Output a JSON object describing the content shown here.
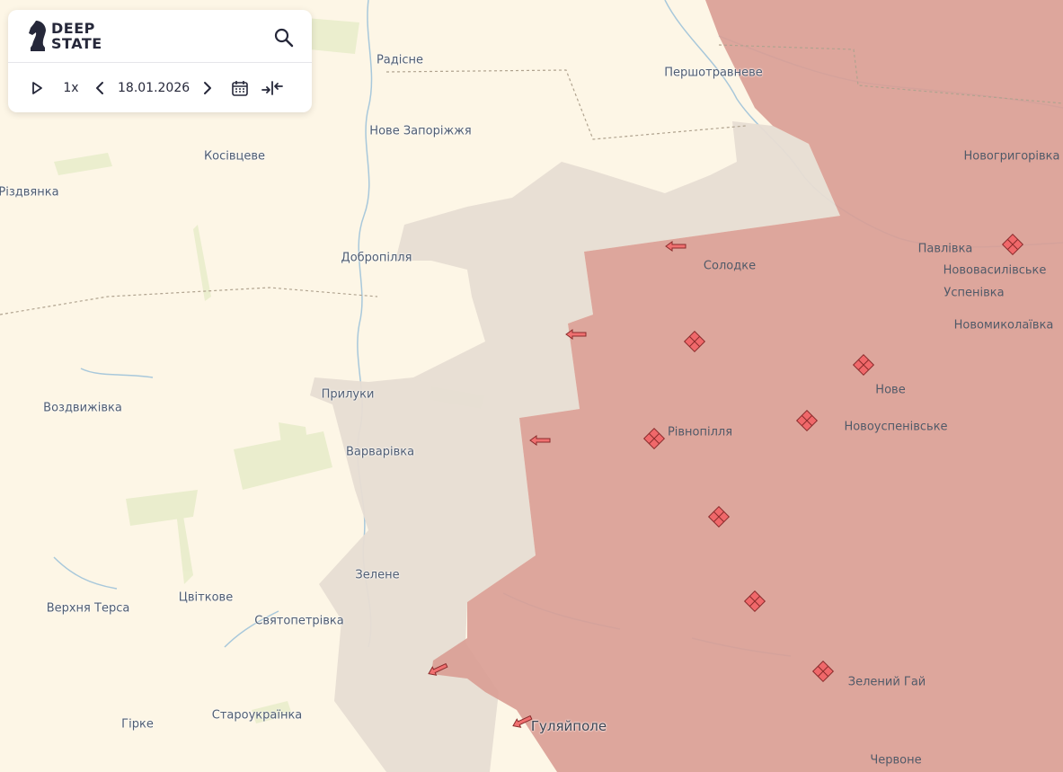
{
  "brand": {
    "line1": "DEEP",
    "line2": "STATE"
  },
  "timeline": {
    "speed": "1x",
    "date": "18.01.2026"
  },
  "icons": {
    "logo": "knight-chess-piece-icon",
    "search": "search-icon",
    "play": "play-icon",
    "prev": "chevron-left-icon",
    "next": "chevron-right-icon",
    "calendar": "calendar-icon",
    "collapse": "collapse-arrows-icon",
    "attack": "attack-arrow-icon",
    "fortification": "fortification-marker-icon"
  },
  "colors": {
    "background": "#fdf6e6",
    "occupied": "#d99d93",
    "contested": "#e7ddd3",
    "marker": "#f0686a"
  },
  "places": [
    {
      "name": "Радісне"
    },
    {
      "name": "Першотравневе"
    },
    {
      "name": "Нове Запоріжжя"
    },
    {
      "name": "Косівцеве"
    },
    {
      "name": "Новогригорівка"
    },
    {
      "name": "Різдвянка"
    },
    {
      "name": "Добропілля"
    },
    {
      "name": "Солодке"
    },
    {
      "name": "Павлівка"
    },
    {
      "name": "Нововасилівське"
    },
    {
      "name": "Успенівка"
    },
    {
      "name": "Новомиколаївка"
    },
    {
      "name": "Нове"
    },
    {
      "name": "Прилуки"
    },
    {
      "name": "Воздвижівка"
    },
    {
      "name": "Рівнопілля"
    },
    {
      "name": "Новоуспенівське"
    },
    {
      "name": "Варварівка"
    },
    {
      "name": "Зелене"
    },
    {
      "name": "Верхня Терса"
    },
    {
      "name": "Цвіткове"
    },
    {
      "name": "Святопетрівка"
    },
    {
      "name": "Зелений Гай"
    },
    {
      "name": "Гірке"
    },
    {
      "name": "Староукраїнка"
    },
    {
      "name": "Гуляйполе"
    },
    {
      "name": "Червоне"
    }
  ]
}
